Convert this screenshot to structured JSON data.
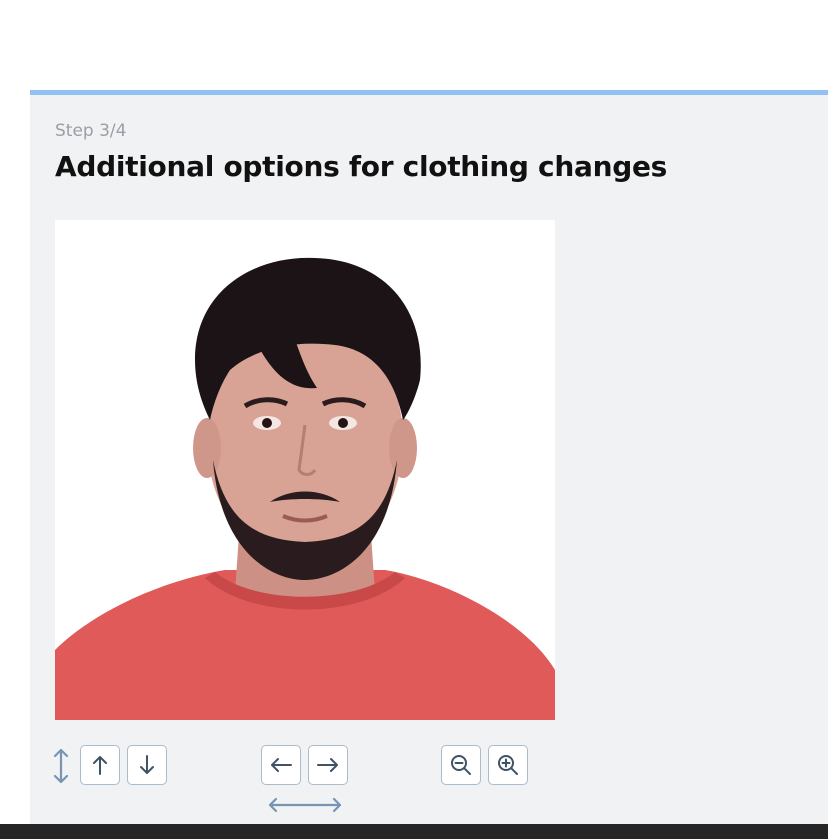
{
  "header": {
    "step_label": "Step 3/4",
    "title": "Additional options for clothing changes"
  },
  "photo": {
    "subject": "portrait of a bearded man with dark hair wearing a coral-red sweatshirt",
    "background_color": "#ffffff",
    "shirt_color": "#e05a5a",
    "hair_color": "#1c1316",
    "skin_color": "#d8a294"
  },
  "controls": {
    "vertical": [
      "vertical-axis-icon",
      "arrow-up-icon",
      "arrow-down-icon"
    ],
    "horizontal": [
      "arrow-left-icon",
      "arrow-right-icon",
      "horizontal-axis-icon"
    ],
    "zoom": [
      "zoom-out-icon",
      "zoom-in-icon"
    ]
  },
  "colors": {
    "panel_background": "#f1f2f4",
    "accent_top_border": "#93c1f3",
    "button_border": "#a9bccd",
    "icon_color": "#3e5366",
    "axis_icon_color": "#7795b3",
    "bottom_bar": "#262626"
  }
}
